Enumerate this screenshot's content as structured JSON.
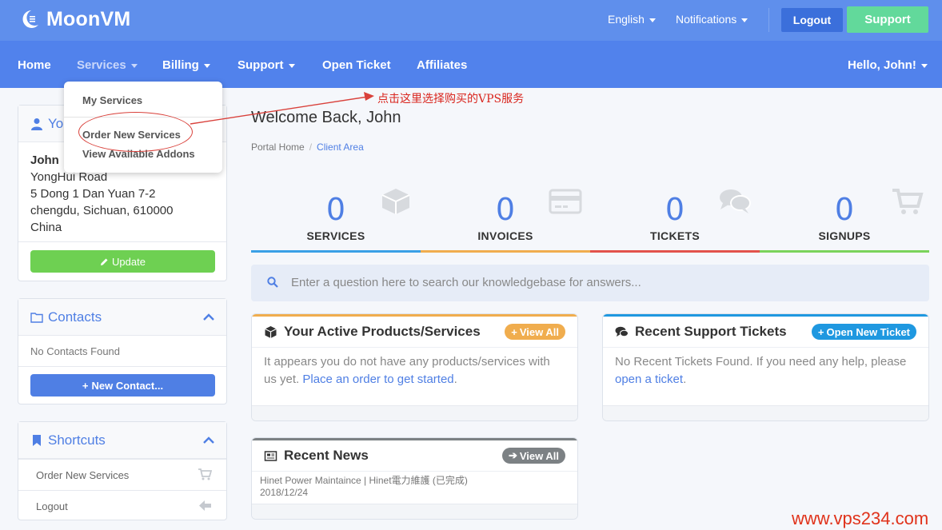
{
  "brand": {
    "name": "MoonVM"
  },
  "topbar": {
    "language": "English",
    "notifications": "Notifications",
    "logout": "Logout",
    "support": "Support"
  },
  "nav": {
    "items": [
      {
        "label": "Home"
      },
      {
        "label": "Services"
      },
      {
        "label": "Billing"
      },
      {
        "label": "Support"
      },
      {
        "label": "Open Ticket"
      },
      {
        "label": "Affiliates"
      }
    ],
    "greeting": "Hello, John!"
  },
  "dropdown": {
    "items": [
      "My Services",
      "Order New Services",
      "View Available Addons"
    ]
  },
  "annotation": {
    "text": "点击这里选择购买的VPS服务",
    "color": "#d9251d"
  },
  "sidebar": {
    "info_panel": {
      "title_visible": "Yo",
      "name": "John",
      "address_lines": [
        "YongHui Road",
        "5 Dong 1 Dan Yuan 7-2",
        "chengdu, Sichuan, 610000",
        "China"
      ],
      "update_button": "Update"
    },
    "contacts_panel": {
      "title": "Contacts",
      "empty_text": "No Contacts Found",
      "new_button": "New Contact..."
    },
    "shortcuts_panel": {
      "title": "Shortcuts",
      "items": [
        {
          "label": "Order New Services",
          "icon": "cart-icon"
        },
        {
          "label": "Logout",
          "icon": "arrow-left-icon"
        }
      ]
    }
  },
  "main": {
    "welcome": "Welcome Back, John",
    "breadcrumb": [
      "Portal Home",
      "Client Area"
    ],
    "stats": [
      {
        "value": "0",
        "label": "SERVICES",
        "color": "#3aa0e6"
      },
      {
        "value": "0",
        "label": "INVOICES",
        "color": "#f0ad4e"
      },
      {
        "value": "0",
        "label": "TICKETS",
        "color": "#e2534b"
      },
      {
        "value": "0",
        "label": "SIGNUPS",
        "color": "#7ad35b"
      }
    ],
    "kb_placeholder": "Enter a question here to search our knowledgebase for answers...",
    "products_card": {
      "title": "Your Active Products/Services",
      "badge": "View All",
      "body_text": "It appears you do not have any products/services with us yet.",
      "body_link": "Place an order to get started",
      "color": "#f0ad4e"
    },
    "tickets_card": {
      "title": "Recent Support Tickets",
      "badge": "Open New Ticket",
      "body_text": "No Recent Tickets Found. If you need any help, please",
      "body_link": "open a ticket",
      "color": "#1f98e0"
    },
    "news_card": {
      "title": "Recent News",
      "badge": "View All",
      "item_title": "Hinet Power Maintaince | Hinet電力維護 (已完成)",
      "item_date": "2018/12/24",
      "color": "#7c8184"
    }
  },
  "watermark": "www.vps234.com"
}
